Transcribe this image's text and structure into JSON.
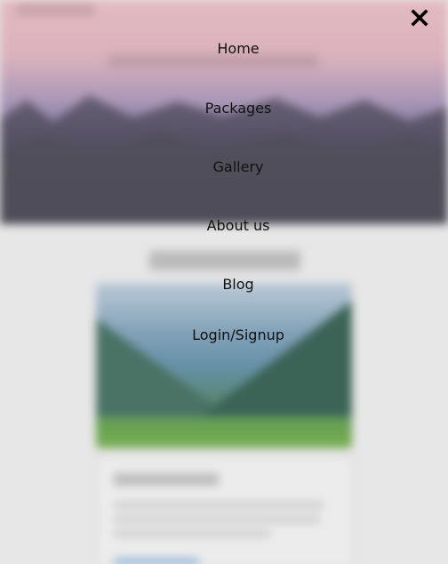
{
  "nav": {
    "items": [
      {
        "label": "Home"
      },
      {
        "label": "Packages"
      },
      {
        "label": "Gallery"
      },
      {
        "label": "About us"
      },
      {
        "label": "Blog"
      },
      {
        "label": "Login/Signup"
      }
    ]
  },
  "close_icon": "close-icon",
  "colors": {
    "menu_text": "#111111",
    "backdrop": "#e6e6e6",
    "hero_top": "#e3b7bd",
    "hero_bottom": "#4a4857"
  }
}
